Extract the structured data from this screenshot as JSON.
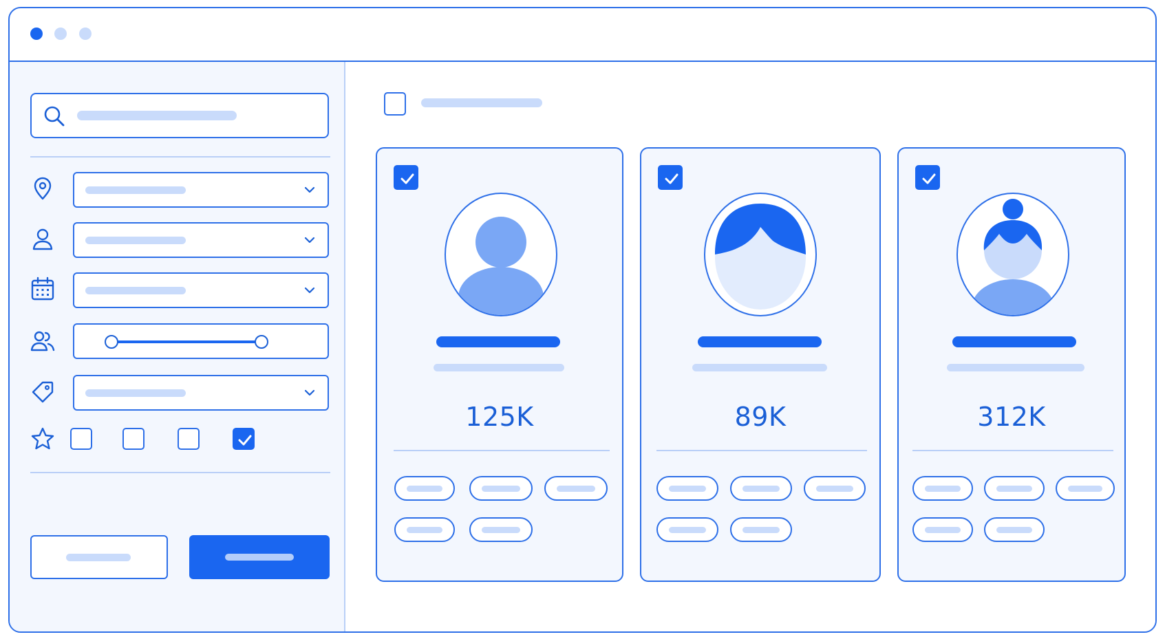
{
  "window": {
    "controls": [
      "window-close-dot",
      "window-minimize-dot",
      "window-zoom-dot"
    ]
  },
  "sidebar": {
    "search": {
      "icon": "search-icon",
      "placeholder": ""
    },
    "filters": [
      {
        "icon": "map-pin-icon",
        "type": "select"
      },
      {
        "icon": "user-icon",
        "type": "select"
      },
      {
        "icon": "calendar-icon",
        "type": "select"
      },
      {
        "icon": "users-icon",
        "type": "range-slider"
      },
      {
        "icon": "tag-icon",
        "type": "select"
      }
    ],
    "rating": {
      "icon": "star-icon",
      "options": [
        {
          "checked": false
        },
        {
          "checked": false
        },
        {
          "checked": false
        },
        {
          "checked": true
        }
      ]
    },
    "range": {
      "low": 0.0,
      "high": 1.0
    }
  },
  "toolbar": {
    "select_all_checked": false,
    "view_modes": [
      {
        "icon": "grid-view-icon",
        "active": true
      },
      {
        "icon": "list-view-icon",
        "active": false
      }
    ]
  },
  "cards": [
    {
      "checked": true,
      "avatar": "person-short-hair-icon",
      "metric": "125K",
      "chips": 5
    },
    {
      "checked": true,
      "avatar": "person-bob-hair-icon",
      "metric": "89K",
      "chips": 5
    },
    {
      "checked": true,
      "avatar": "person-bun-hair-icon",
      "metric": "312K",
      "chips": 5
    }
  ],
  "colors": {
    "accent": "#1a66f0",
    "outline": "#2d6fe8",
    "placeholder": "#c9dbfb",
    "panel": "#f3f7fe"
  }
}
